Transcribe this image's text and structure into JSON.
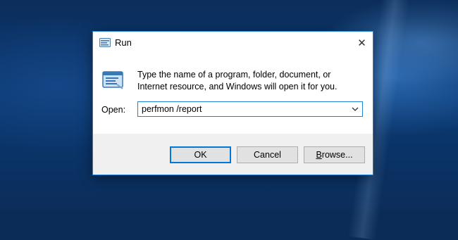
{
  "window": {
    "title": "Run",
    "close_glyph": "✕",
    "icon": "run-app-icon"
  },
  "dialog": {
    "prompt": "Type the name of a program, folder, document, or Internet resource, and Windows will open it for you.",
    "open_label": "Open:",
    "open_value": "perfmon /report",
    "open_dropdown_icon": "chevron-down-icon"
  },
  "buttons": {
    "ok": "OK",
    "cancel": "Cancel",
    "browse": "Browse..."
  },
  "colors": {
    "accent": "#0078d7",
    "desktop": "#0a2c57",
    "footer": "#f0f0f0"
  }
}
